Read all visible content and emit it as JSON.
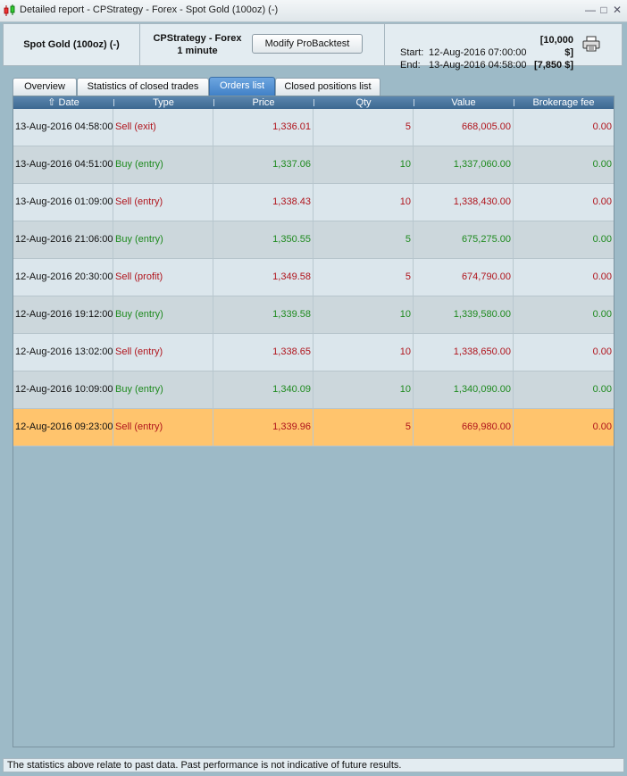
{
  "window": {
    "title": "Detailed report - CPStrategy - Forex - Spot Gold (100oz) (-)",
    "controls": [
      "minimize-icon",
      "maximize-icon",
      "close-icon"
    ]
  },
  "header": {
    "instrument": "Spot Gold (100oz) (-)",
    "strategy_line1": "CPStrategy - Forex",
    "strategy_line2": "1 minute",
    "modify_button": "Modify ProBacktest",
    "start_label": "Start:",
    "start_datetime": "12-Aug-2016 07:00:00",
    "start_amount": "[10,000 $]",
    "end_label": "End:",
    "end_datetime": "13-Aug-2016 04:58:00",
    "end_amount": "[7,850 $]"
  },
  "tabs": [
    {
      "label": "Overview",
      "active": false
    },
    {
      "label": "Statistics of closed trades",
      "active": false
    },
    {
      "label": "Orders list",
      "active": true
    },
    {
      "label": "Closed positions list",
      "active": false
    }
  ],
  "table": {
    "columns": [
      "Date",
      "Type",
      "Price",
      "Qty",
      "Value",
      "Brokerage fee"
    ],
    "sort_indicator": "sort-up-icon",
    "rows": [
      {
        "date": "13-Aug-2016 04:58:00",
        "type": "Sell (exit)",
        "side": "sell",
        "price": "1,336.01",
        "qty": "5",
        "value": "668,005.00",
        "fee": "0.00"
      },
      {
        "date": "13-Aug-2016 04:51:00",
        "type": "Buy (entry)",
        "side": "buy",
        "price": "1,337.06",
        "qty": "10",
        "value": "1,337,060.00",
        "fee": "0.00"
      },
      {
        "date": "13-Aug-2016 01:09:00",
        "type": "Sell (entry)",
        "side": "sell",
        "price": "1,338.43",
        "qty": "10",
        "value": "1,338,430.00",
        "fee": "0.00"
      },
      {
        "date": "12-Aug-2016 21:06:00",
        "type": "Buy (entry)",
        "side": "buy",
        "price": "1,350.55",
        "qty": "5",
        "value": "675,275.00",
        "fee": "0.00"
      },
      {
        "date": "12-Aug-2016 20:30:00",
        "type": "Sell (profit)",
        "side": "sell",
        "price": "1,349.58",
        "qty": "5",
        "value": "674,790.00",
        "fee": "0.00"
      },
      {
        "date": "12-Aug-2016 19:12:00",
        "type": "Buy (entry)",
        "side": "buy",
        "price": "1,339.58",
        "qty": "10",
        "value": "1,339,580.00",
        "fee": "0.00"
      },
      {
        "date": "12-Aug-2016 13:02:00",
        "type": "Sell (entry)",
        "side": "sell",
        "price": "1,338.65",
        "qty": "10",
        "value": "1,338,650.00",
        "fee": "0.00"
      },
      {
        "date": "12-Aug-2016 10:09:00",
        "type": "Buy (entry)",
        "side": "buy",
        "price": "1,340.09",
        "qty": "10",
        "value": "1,340,090.00",
        "fee": "0.00"
      },
      {
        "date": "12-Aug-2016 09:23:00",
        "type": "Sell (entry)",
        "side": "sell",
        "price": "1,339.96",
        "qty": "5",
        "value": "669,980.00",
        "fee": "0.00",
        "selected": true
      }
    ]
  },
  "footer": {
    "disclaimer": "The statistics above relate to past data. Past performance is not indicative of future results."
  },
  "colors": {
    "background": "#9dbac7",
    "header_bar": "#3c6891",
    "active_tab": "#4a8ad0",
    "sell": "#b0141c",
    "buy": "#1e8a1e",
    "selected_row": "#ffc46d"
  }
}
